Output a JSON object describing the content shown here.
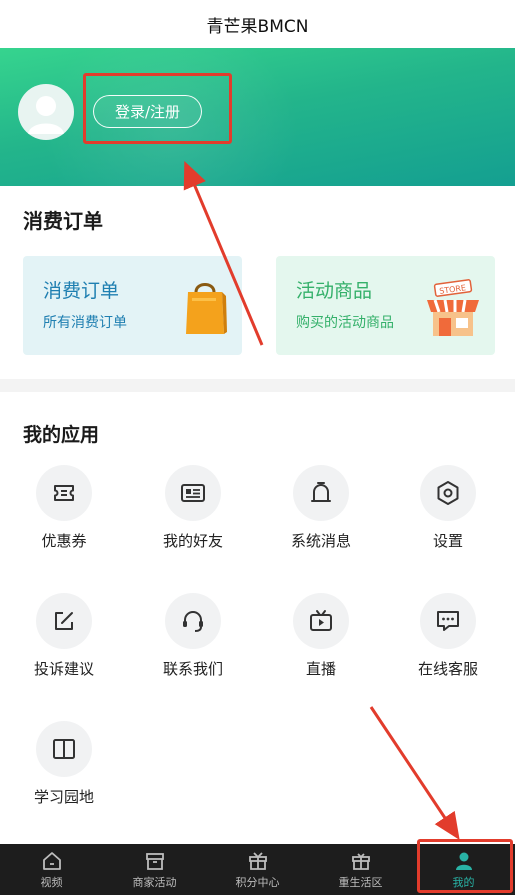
{
  "header": {
    "title": "青芒果BMCN"
  },
  "profile": {
    "login_label": "登录/注册"
  },
  "orders": {
    "section_title": "消费订单",
    "cards": [
      {
        "title": "消费订单",
        "subtitle": "所有消费订单",
        "icon": "shopping-bag-icon"
      },
      {
        "title": "活动商品",
        "subtitle": "购买的活动商品",
        "icon": "store-icon"
      }
    ]
  },
  "apps": {
    "section_title": "我的应用",
    "items": [
      {
        "label": "优惠券",
        "icon": "ticket-icon"
      },
      {
        "label": "我的好友",
        "icon": "contact-card-icon"
      },
      {
        "label": "系统消息",
        "icon": "message-bell-icon"
      },
      {
        "label": "设置",
        "icon": "settings-hexagon-icon"
      },
      {
        "label": "投诉建议",
        "icon": "edit-icon"
      },
      {
        "label": "联系我们",
        "icon": "headset-icon"
      },
      {
        "label": "直播",
        "icon": "tv-icon"
      },
      {
        "label": "在线客服",
        "icon": "chat-icon"
      },
      {
        "label": "学习园地",
        "icon": "book-icon"
      }
    ]
  },
  "tabbar": {
    "items": [
      {
        "label": "视频",
        "icon": "home-icon"
      },
      {
        "label": "商家活动",
        "icon": "box-icon"
      },
      {
        "label": "积分中心",
        "icon": "gift-icon"
      },
      {
        "label": "重生活区",
        "icon": "gift-box-icon"
      },
      {
        "label": "我的",
        "icon": "user-icon"
      }
    ],
    "active_index": 4
  },
  "colors": {
    "accent": "#29b3a6",
    "highlight": "#e23c2c",
    "hero_start": "#36d48e",
    "hero_end": "#149f91"
  }
}
